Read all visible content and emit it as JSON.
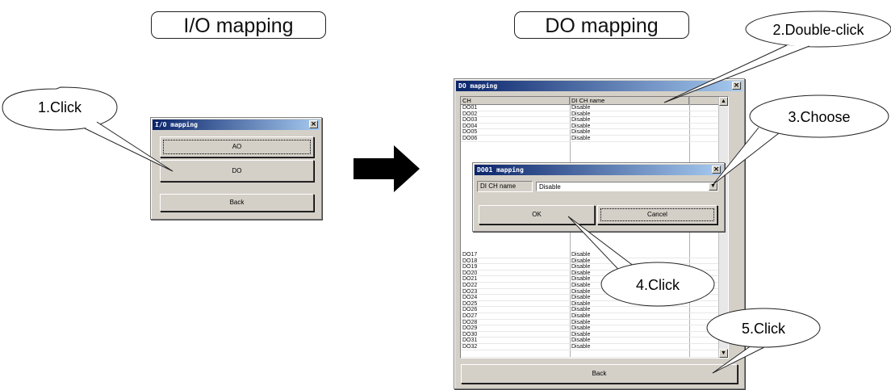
{
  "headings": {
    "io": "I/O mapping",
    "do": "DO mapping"
  },
  "callouts": [
    "1.Click",
    "2.Double-click",
    "3.Choose",
    "4.Click",
    "5.Click"
  ],
  "io_window": {
    "title": "I/O mapping",
    "buttons": {
      "ao": "AO",
      "do": "DO",
      "back": "Back"
    }
  },
  "do_window": {
    "title": "DO mapping",
    "columns": [
      "CH",
      "DI CH name"
    ],
    "rows_top": [
      [
        "DO01",
        "Disable"
      ],
      [
        "DO02",
        "Disable"
      ],
      [
        "DO03",
        "Disable"
      ],
      [
        "DO04",
        "Disable"
      ],
      [
        "DO05",
        "Disable"
      ],
      [
        "DO06",
        "Disable"
      ]
    ],
    "rows_bottom": [
      [
        "DO17",
        "Disable"
      ],
      [
        "DO18",
        "Disable"
      ],
      [
        "DO19",
        "Disable"
      ],
      [
        "DO20",
        "Disable"
      ],
      [
        "DO21",
        "Disable"
      ],
      [
        "DO22",
        "Disable"
      ],
      [
        "DO23",
        "Disable"
      ],
      [
        "DO24",
        "Disable"
      ],
      [
        "DO25",
        "Disable"
      ],
      [
        "DO26",
        "Disable"
      ],
      [
        "DO27",
        "Disable"
      ],
      [
        "DO28",
        "Disable"
      ],
      [
        "DO29",
        "Disable"
      ],
      [
        "DO30",
        "Disable"
      ],
      [
        "DO31",
        "Disable"
      ],
      [
        "DO32",
        "Disable"
      ]
    ],
    "back": "Back"
  },
  "dialog": {
    "title": "DO01 mapping",
    "label": "DI CH name",
    "value": "Disable",
    "ok": "OK",
    "cancel": "Cancel"
  },
  "colors": {
    "titlebar_start": "#0a246a",
    "titlebar_end": "#a6caf0",
    "window_bg": "#d4d0c8"
  }
}
